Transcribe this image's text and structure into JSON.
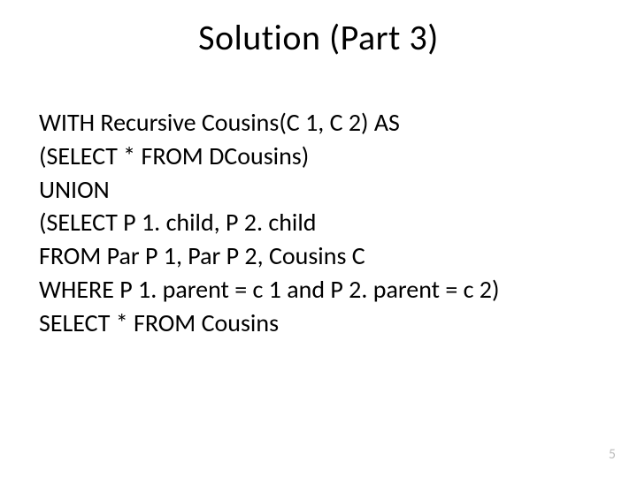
{
  "title": "Solution (Part 3)",
  "lines": [
    "WITH Recursive Cousins(C 1, C 2) AS",
    "(SELECT * FROM DCousins)",
    "UNION",
    "(SELECT P 1. child, P 2. child",
    "FROM Par P 1, Par P 2, Cousins C",
    "WHERE P 1. parent = c 1 and P 2. parent = c 2)",
    "SELECT * FROM Cousins"
  ],
  "page_number": "5"
}
